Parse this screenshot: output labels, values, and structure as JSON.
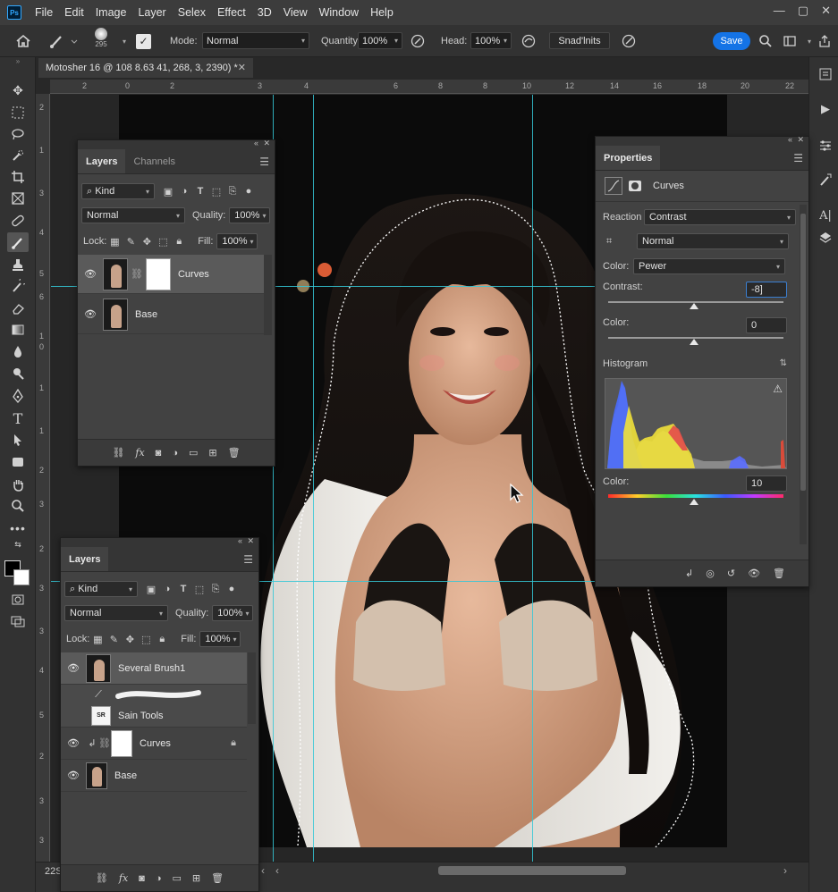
{
  "menu": {
    "logo": "Ps",
    "items": [
      "File",
      "Edit",
      "Image",
      "Layer",
      "Selex",
      "Effect",
      "3D",
      "View",
      "Window",
      "Help"
    ],
    "win_min": "—",
    "win_max": "▢",
    "win_close": "✕"
  },
  "options": {
    "brush_size": "295",
    "mode_label": "Mode:",
    "mode_value": "Normal",
    "quantity_label": "Quantity:",
    "quantity_value": "100%",
    "head_label": "Head:",
    "head_value": "100%",
    "snad_button": "Snad'lnits",
    "save": "Save"
  },
  "document": {
    "tab_title": "Motosher 16 @ 108 8.63 41, 268, 3, 2390) *",
    "close": "✕"
  },
  "rulers": {
    "top": [
      "2",
      "0",
      "2",
      "3",
      "4",
      "6",
      "8",
      "8",
      "10",
      "12",
      "14",
      "16",
      "18",
      "20",
      "22"
    ],
    "left": [
      "2",
      "1",
      "3",
      "4",
      "5",
      "6",
      "1",
      "0",
      "1",
      "1",
      "2",
      "3",
      "2",
      "3",
      "3",
      "4",
      "5",
      "2",
      "3",
      "3"
    ]
  },
  "status": {
    "zoom": "22S"
  },
  "layers_panel_1": {
    "tabs": [
      "Layers",
      "Channels"
    ],
    "kind": "Kind",
    "blend": "Normal",
    "quality_label": "Quality:",
    "quality_value": "100%",
    "lock_label": "Lock:",
    "fill_label": "Fill:",
    "fill_value": "100%",
    "layers": [
      {
        "name": "Curves",
        "visible": true,
        "selected": true
      },
      {
        "name": "Base",
        "visible": true,
        "selected": false
      }
    ]
  },
  "layers_panel_2": {
    "tabs": [
      "Layers"
    ],
    "kind": "Kind",
    "blend": "Normal",
    "quality_label": "Quality:",
    "quality_value": "100%",
    "lock_label": "Lock:",
    "fill_label": "Fill:",
    "fill_value": "100%",
    "layers": [
      {
        "name": "Several Brush1",
        "visible": true
      },
      {
        "name": "Sain Tools",
        "visible": false
      },
      {
        "name": "Curves",
        "visible": true
      },
      {
        "name": "Base",
        "visible": true
      }
    ]
  },
  "properties": {
    "tab": "Properties",
    "adjustment": "Curves",
    "reaction_label": "Reaction",
    "reaction_value": "Contrast",
    "blend_value": "Normal",
    "color_label": "Color:",
    "color_value": "Pewer",
    "contrast_label": "Contrast:",
    "contrast_value": "-8]",
    "contrast_level": 0.49,
    "color2_label": "Color:",
    "color2_value": "0",
    "color2_level": 0.49,
    "histogram_label": "Histogram",
    "color3_label": "Color:",
    "color3_value": "10",
    "color3_level": 0.49
  },
  "colors": {
    "accent": "#1473e6",
    "guide": "#35c7d6",
    "panel": "#424242"
  }
}
